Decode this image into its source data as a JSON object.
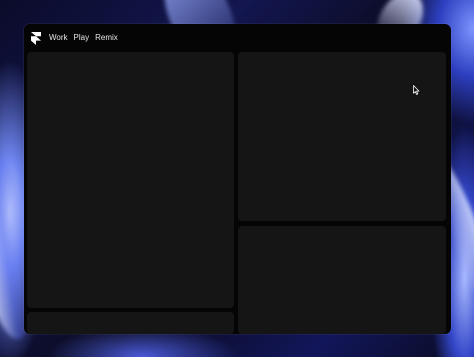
{
  "window": {
    "nav": [
      {
        "label": "Work"
      },
      {
        "label": "Play"
      },
      {
        "label": "Remix"
      }
    ]
  },
  "icons": {
    "logo": "framer-logo-icon",
    "cursor": "mouse-pointer-icon"
  },
  "colors": {
    "window_background": "#050505",
    "panel_background": "#151515",
    "nav_text": "#e6e6e6",
    "wallpaper_accent": "#6f86f0"
  }
}
